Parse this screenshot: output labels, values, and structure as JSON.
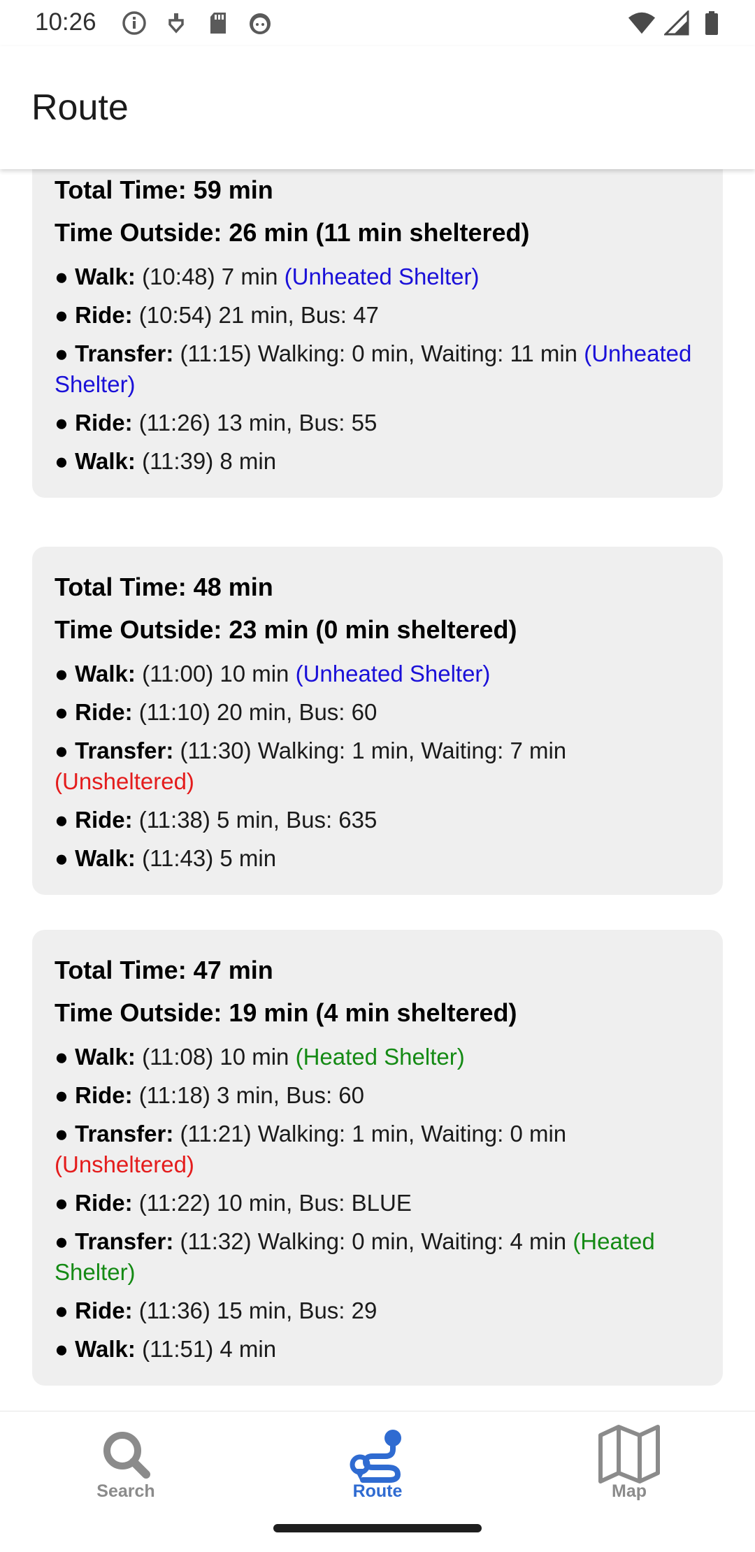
{
  "status_bar": {
    "time": "10:26"
  },
  "app_bar": {
    "title": "Route"
  },
  "colors": {
    "unheated": "#1a10d8",
    "heated": "#148a14",
    "unsheltered": "#e41c1c",
    "nav_active": "#2f6bd1",
    "nav_inactive": "#8b8b8b"
  },
  "routes": [
    {
      "total_time": "Total Time: 59 min",
      "time_outside": "Time Outside: 26 min (11 min sheltered)",
      "steps": [
        {
          "bullet": "● ",
          "type": "Walk:",
          "detail": " (10:48) 7 min ",
          "shelter": "(Unheated Shelter)"
        },
        {
          "bullet": "● ",
          "type": "Ride:",
          "detail": " (10:54) 21 min, Bus: 47",
          "shelter": ""
        },
        {
          "bullet": "● ",
          "type": "Transfer:",
          "detail": " (11:15) Walking: 0 min, Waiting: 11 min ",
          "shelter": "(Unheated Shelter)"
        },
        {
          "bullet": "● ",
          "type": "Ride:",
          "detail": " (11:26) 13 min, Bus: 55",
          "shelter": ""
        },
        {
          "bullet": "● ",
          "type": "Walk:",
          "detail": " (11:39) 8 min",
          "shelter": ""
        }
      ]
    },
    {
      "total_time": "Total Time: 48 min",
      "time_outside": "Time Outside: 23 min (0 min sheltered)",
      "steps": [
        {
          "bullet": "● ",
          "type": "Walk:",
          "detail": " (11:00) 10 min ",
          "shelter": "(Unheated Shelter)"
        },
        {
          "bullet": "● ",
          "type": "Ride:",
          "detail": " (11:10) 20 min, Bus: 60",
          "shelter": ""
        },
        {
          "bullet": "● ",
          "type": "Transfer:",
          "detail": " (11:30) Walking: 1 min, Waiting: 7 min ",
          "shelter": "(Unsheltered)"
        },
        {
          "bullet": "● ",
          "type": "Ride:",
          "detail": " (11:38) 5 min, Bus: 635",
          "shelter": ""
        },
        {
          "bullet": "● ",
          "type": "Walk:",
          "detail": " (11:43) 5 min",
          "shelter": ""
        }
      ]
    },
    {
      "total_time": "Total Time: 47 min",
      "time_outside": "Time Outside: 19 min (4 min sheltered)",
      "steps": [
        {
          "bullet": "● ",
          "type": "Walk:",
          "detail": " (11:08) 10 min ",
          "shelter": "(Heated Shelter)"
        },
        {
          "bullet": "● ",
          "type": "Ride:",
          "detail": " (11:18) 3 min, Bus: 60",
          "shelter": ""
        },
        {
          "bullet": "● ",
          "type": "Transfer:",
          "detail": " (11:21) Walking: 1 min, Waiting: 0 min ",
          "shelter": "(Unsheltered)"
        },
        {
          "bullet": "● ",
          "type": "Ride:",
          "detail": " (11:22) 10 min, Bus: BLUE",
          "shelter": ""
        },
        {
          "bullet": "● ",
          "type": "Transfer:",
          "detail": " (11:32) Walking: 0 min, Waiting: 4 min ",
          "shelter": "(Heated Shelter)"
        },
        {
          "bullet": "● ",
          "type": "Ride:",
          "detail": " (11:36) 15 min, Bus: 29",
          "shelter": ""
        },
        {
          "bullet": "● ",
          "type": "Walk:",
          "detail": " (11:51) 4 min",
          "shelter": ""
        }
      ]
    }
  ],
  "bottom_nav": {
    "search_label": "Search",
    "route_label": "Route",
    "map_label": "Map",
    "active": "route"
  }
}
